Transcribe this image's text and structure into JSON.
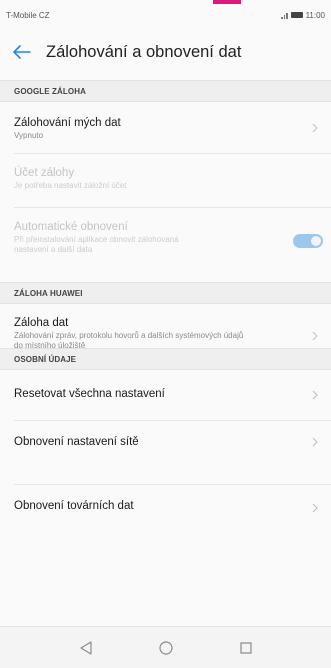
{
  "status_bar": {
    "carrier": "T-Mobile CZ",
    "time": "11:00"
  },
  "header": {
    "title": "Zálohování a obnovení dat"
  },
  "sections": {
    "google": {
      "header": "GOOGLE ZÁLOHA",
      "backup_my_data": {
        "title": "Zálohování mých dat",
        "subtitle": "Vypnuto"
      },
      "backup_account": {
        "title": "Účet zálohy",
        "subtitle": "Je potřeba nastavit záložní účet"
      },
      "auto_restore": {
        "title": "Automatické obnovení",
        "subtitle": "Při přeinstalování aplikace obnovit zálohovaná nastavení a další data",
        "toggle_on": true
      }
    },
    "huawei": {
      "header": "ZÁLOHA HUAWEI",
      "data_backup": {
        "title": "Záloha dat",
        "subtitle": "Zálohování zpráv, protokolu hovorů a dalších systémových údajů do místního úložiště"
      }
    },
    "personal": {
      "header": "OSOBNÍ ÚDAJE",
      "reset_all": {
        "title": "Resetovat všechna nastavení"
      },
      "network_reset": {
        "title": "Obnovení nastavení sítě"
      },
      "factory_reset": {
        "title": "Obnovení továrních dat"
      }
    }
  },
  "icons": {
    "back": "arrow-left-icon",
    "chevron": "chevron-right-icon",
    "nav_back": "triangle-back-icon",
    "nav_home": "circle-home-icon",
    "nav_recent": "square-recent-icon"
  },
  "colors": {
    "accent": "#1e88e5",
    "toggle_disabled": "#9ec7ec",
    "brand_notch": "#e0177a"
  }
}
